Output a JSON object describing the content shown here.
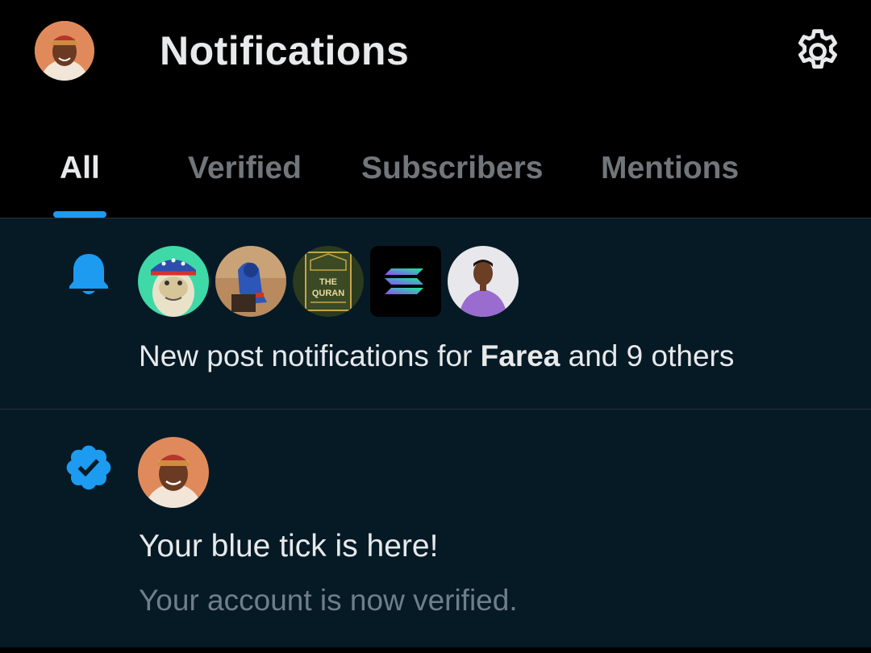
{
  "header": {
    "title": "Notifications",
    "avatar_icon": "user-avatar",
    "settings_icon": "gear-icon"
  },
  "tabs": [
    {
      "label": "All",
      "active": true
    },
    {
      "label": "Verified",
      "active": false
    },
    {
      "label": "Subscribers",
      "active": false
    },
    {
      "label": "Mentions",
      "active": false
    }
  ],
  "notifications": [
    {
      "icon": "bell-icon",
      "avatars": [
        "ape-avatar",
        "hooded-person-avatar",
        "quran-avatar",
        "solana-logo-avatar",
        "man-purple-avatar"
      ],
      "text_prefix": "New post notifications for ",
      "text_bold": "Farea",
      "text_suffix": " and 9 others"
    },
    {
      "icon": "verified-badge-icon",
      "avatars": [
        "user-avatar"
      ],
      "headline": "Your blue tick is here!",
      "subline": "Your account is now verified."
    }
  ],
  "colors": {
    "accent": "#1d9bf0",
    "background": "#000000",
    "content_bg": "#061a26",
    "text_primary": "#e7e9ea",
    "text_secondary": "#71767b"
  }
}
